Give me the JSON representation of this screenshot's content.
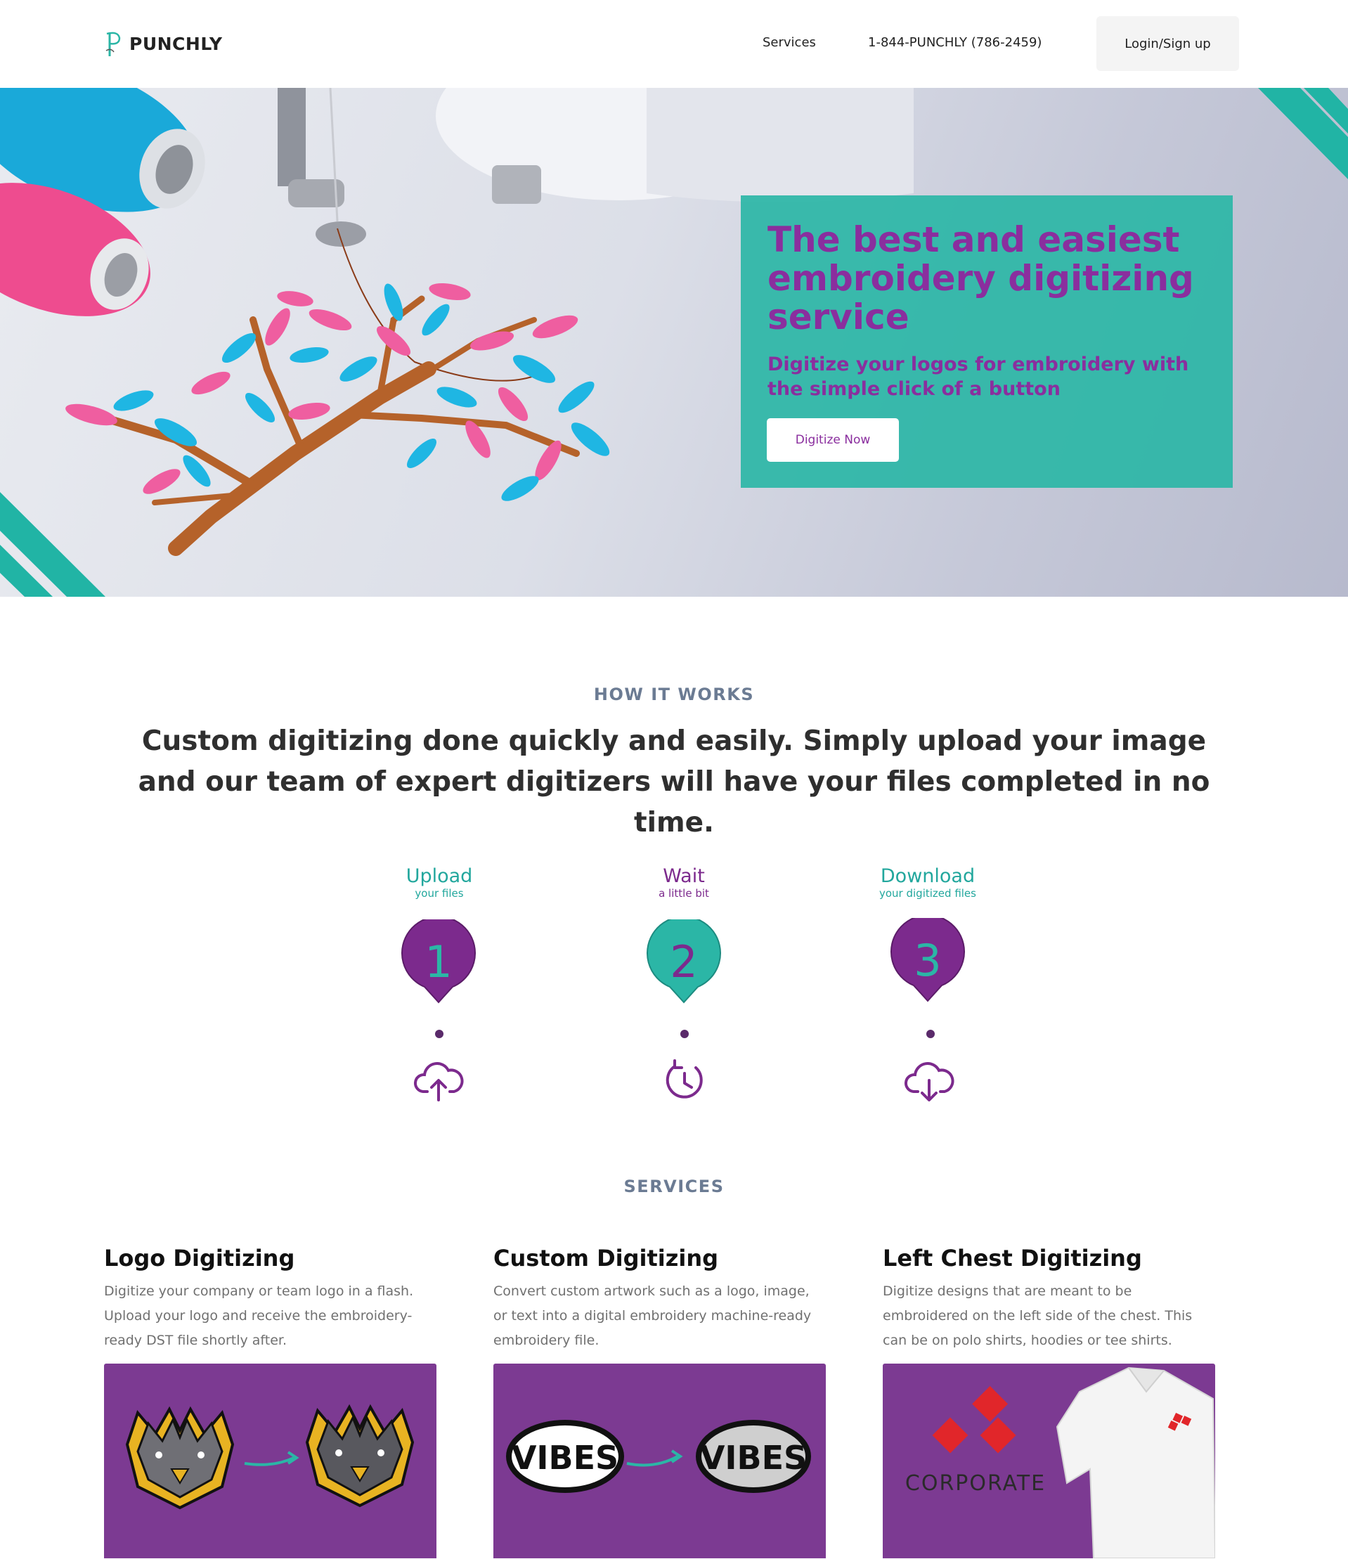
{
  "header": {
    "brand": "PUNCHLY",
    "nav_services": "Services",
    "nav_phone": "1-844-PUNCHLY (786-2459)",
    "login_label": "Login/Sign up"
  },
  "hero": {
    "title": "The best and easiest embroidery digitizing service",
    "subtitle": "Digitize your logos for embroidery with the simple click of a button",
    "cta_label": "Digitize Now"
  },
  "how_it_works": {
    "label": "HOW IT WORKS",
    "heading": "Custom digitizing done quickly and easily. Simply upload your image and our team of expert digitizers will have your files completed in no time.",
    "steps": [
      {
        "title": "Upload",
        "subtitle": "your files",
        "number": "1",
        "icon": "cloud-upload-icon"
      },
      {
        "title": "Wait",
        "subtitle": "a little bit",
        "number": "2",
        "icon": "clock-icon"
      },
      {
        "title": "Download",
        "subtitle": "your digitized files",
        "number": "3",
        "icon": "cloud-download-icon"
      }
    ]
  },
  "services": {
    "label": "SERVICES",
    "items": [
      {
        "title": "Logo Digitizing",
        "description": "Digitize your company or team logo in a flash. Upload your logo and receive the embroidery-ready DST file shortly after."
      },
      {
        "title": "Custom Digitizing",
        "description": "Convert custom artwork such as a logo, image, or text into a digital embroidery machine-ready embroidery file."
      },
      {
        "title": "Left Chest Digitizing",
        "description": "Digitize designs that are meant to be embroidered on the left side of the chest. This can be on polo shirts, hoodies or tee shirts."
      }
    ],
    "sample_text_vibes": "VIBES",
    "sample_text_corporate": "CORPORATE"
  },
  "colors": {
    "teal": "#2bb6a6",
    "purple": "#8a2e9e",
    "service_bg": "#7c3a92"
  }
}
